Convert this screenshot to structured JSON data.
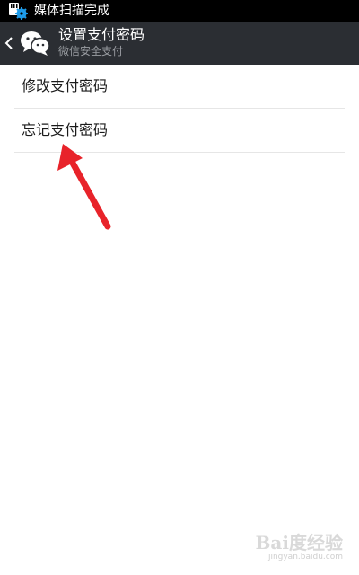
{
  "status_bar": {
    "notification": "媒体扫描完成",
    "notification_icon": "media-scan-gear-icon"
  },
  "action_bar": {
    "title": "设置支付密码",
    "subtitle": "微信安全支付",
    "back_icon": "chevron-left-icon",
    "logo_icon": "wechat-logo-icon"
  },
  "menu": {
    "items": [
      {
        "label": "修改支付密码"
      },
      {
        "label": "忘记支付密码"
      }
    ]
  },
  "annotation": {
    "type": "arrow",
    "color": "#e8232a",
    "points_to": "忘记支付密码"
  },
  "watermark": {
    "brand": "Bai度经验",
    "url": "jingyan.baidu.com"
  },
  "colors": {
    "status_bar_bg": "#000000",
    "action_bar_bg": "#2b2e33",
    "page_bg": "#ffffff",
    "divider": "#e6e6e6",
    "accent_red": "#e8232a"
  }
}
